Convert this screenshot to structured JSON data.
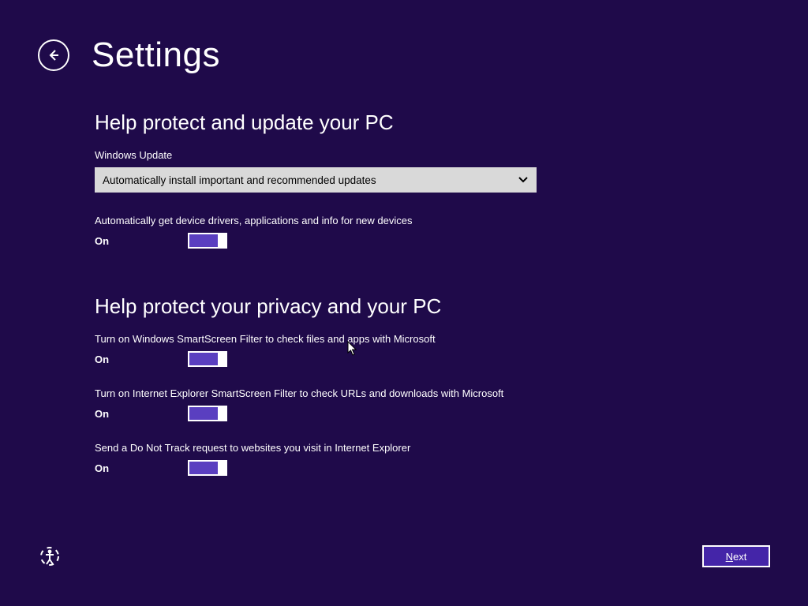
{
  "header": {
    "title": "Settings"
  },
  "sections": {
    "update": {
      "heading": "Help protect and update your PC",
      "windows_update_label": "Windows Update",
      "dropdown_value": "Automatically install important and recommended updates",
      "drivers": {
        "desc": "Automatically get device drivers, applications and info for new devices",
        "state": "On"
      }
    },
    "privacy": {
      "heading": "Help protect your privacy and your PC",
      "smartscreen_files": {
        "desc": "Turn on Windows SmartScreen Filter to check files and apps with Microsoft",
        "state": "On"
      },
      "smartscreen_ie": {
        "desc": "Turn on Internet Explorer SmartScreen Filter to check URLs and downloads with Microsoft",
        "state": "On"
      },
      "dnt": {
        "desc": "Send a Do Not Track request to websites you visit in Internet Explorer",
        "state": "On"
      }
    }
  },
  "footer": {
    "next_first": "N",
    "next_rest": "ext"
  }
}
